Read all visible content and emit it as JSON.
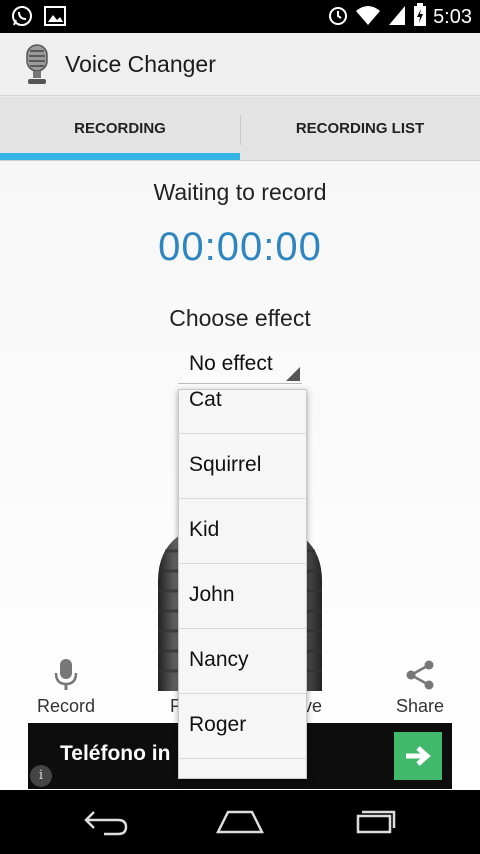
{
  "status_bar": {
    "time": "5:03",
    "left_icons": [
      "whatsapp-icon",
      "image-icon"
    ],
    "right_icons": [
      "alarm-icon",
      "wifi-icon",
      "signal-icon",
      "battery-charging-icon"
    ]
  },
  "app": {
    "title": "Voice Changer",
    "icon": "microphone-icon"
  },
  "tabs": [
    {
      "label": "RECORDING",
      "selected": true
    },
    {
      "label": "RECORDING LIST",
      "selected": false
    }
  ],
  "recording": {
    "status": "Waiting to record",
    "timer": "00:00:00",
    "effect_label": "Choose effect",
    "selected_effect": "No effect"
  },
  "effect_options": [
    {
      "label": "Cat"
    },
    {
      "label": "Squirrel"
    },
    {
      "label": "Kid"
    },
    {
      "label": "John"
    },
    {
      "label": "Nancy"
    },
    {
      "label": "Roger"
    }
  ],
  "actions": {
    "record": "Record",
    "play_partial": "P",
    "save_partial": "ve",
    "share": "Share"
  },
  "ad": {
    "text": "Teléfono in",
    "info": "i"
  },
  "colors": {
    "accent": "#33b5e5",
    "timer": "#2e86c1",
    "ad_button": "#41b96a"
  },
  "nav": [
    "back-icon",
    "home-icon",
    "recent-apps-icon"
  ]
}
